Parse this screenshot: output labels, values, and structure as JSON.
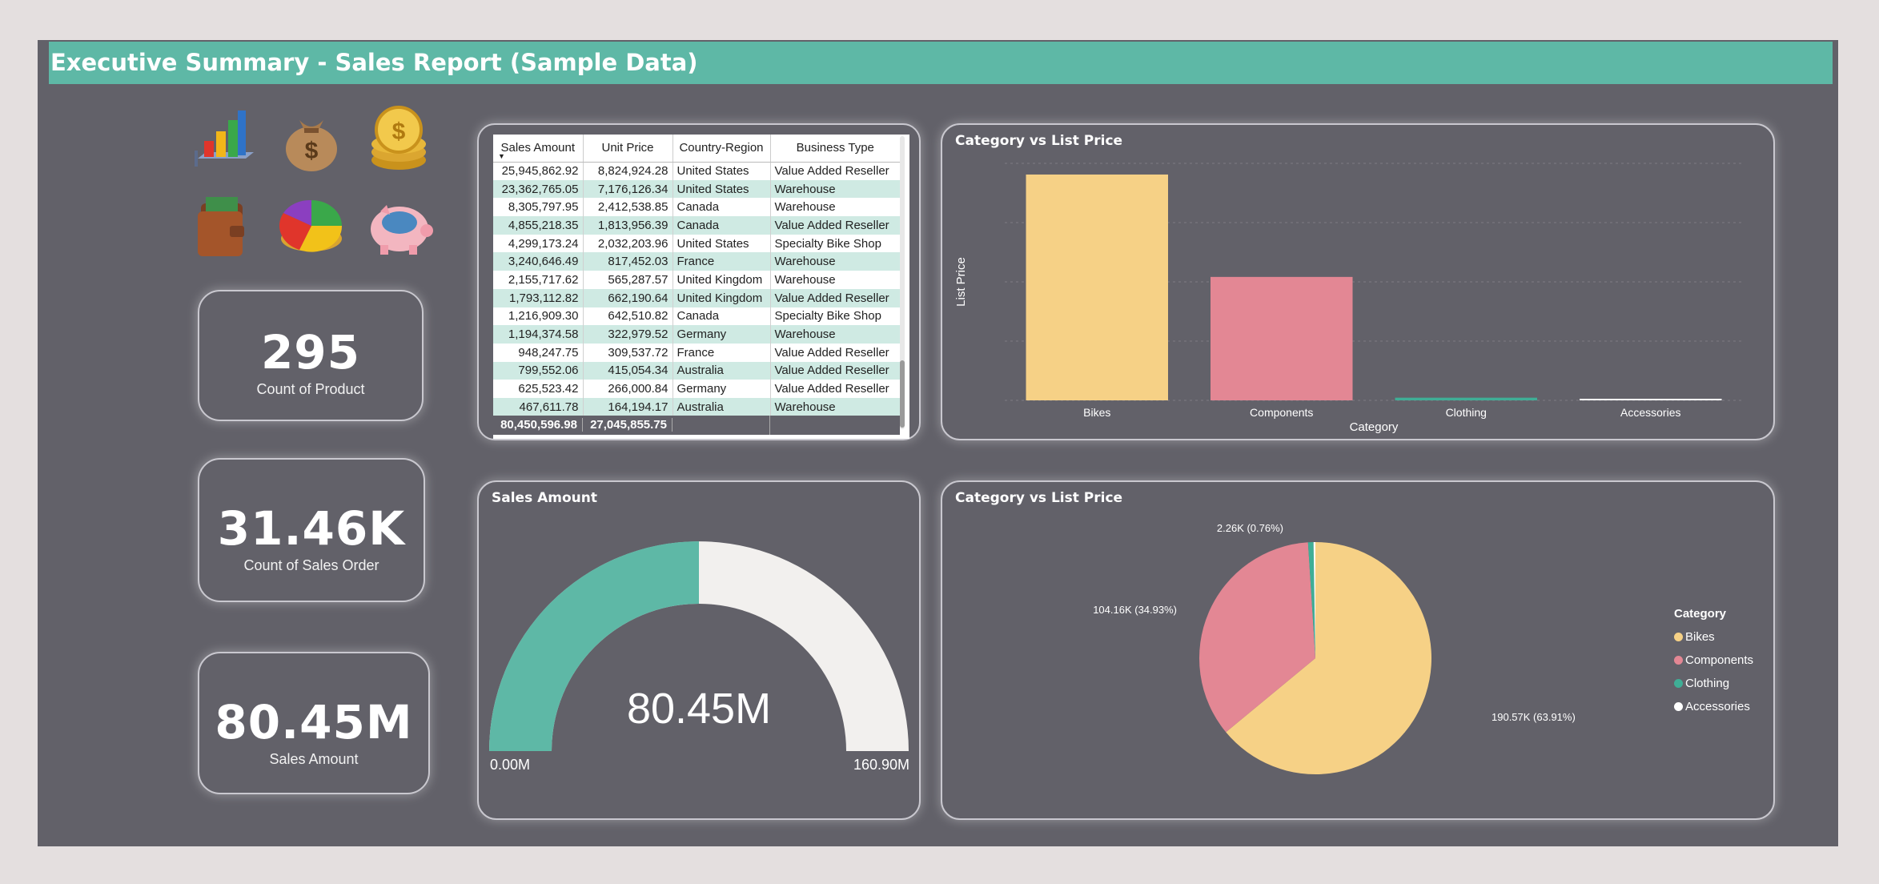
{
  "header": {
    "title": "Executive Summary - Sales Report (Sample Data)"
  },
  "icons": [
    "bar-chart-icon",
    "money-bag-icon",
    "gold-coins-icon",
    "wallet-icon",
    "pie-chart-icon",
    "piggy-bank-icon"
  ],
  "kpis": [
    {
      "value": "295",
      "label": "Count of Product"
    },
    {
      "value": "31.46K",
      "label": "Count of Sales Order"
    },
    {
      "value": "80.45M",
      "label": "Sales Amount"
    }
  ],
  "table": {
    "columns": [
      "Sales Amount",
      "Unit Price",
      "Country-Region",
      "Business Type"
    ],
    "rows": [
      [
        "25,945,862.92",
        "8,824,924.28",
        "United States",
        "Value Added Reseller"
      ],
      [
        "23,362,765.05",
        "7,176,126.34",
        "United States",
        "Warehouse"
      ],
      [
        "8,305,797.95",
        "2,412,538.85",
        "Canada",
        "Warehouse"
      ],
      [
        "4,855,218.35",
        "1,813,956.39",
        "Canada",
        "Value Added Reseller"
      ],
      [
        "4,299,173.24",
        "2,032,203.96",
        "United States",
        "Specialty Bike Shop"
      ],
      [
        "3,240,646.49",
        "817,452.03",
        "France",
        "Warehouse"
      ],
      [
        "2,155,717.62",
        "565,287.57",
        "United Kingdom",
        "Warehouse"
      ],
      [
        "1,793,112.82",
        "662,190.64",
        "United Kingdom",
        "Value Added Reseller"
      ],
      [
        "1,216,909.30",
        "642,510.82",
        "Canada",
        "Specialty Bike Shop"
      ],
      [
        "1,194,374.58",
        "322,979.52",
        "Germany",
        "Warehouse"
      ],
      [
        "948,247.75",
        "309,537.72",
        "France",
        "Value Added Reseller"
      ],
      [
        "799,552.06",
        "415,054.34",
        "Australia",
        "Value Added Reseller"
      ],
      [
        "625,523.42",
        "266,000.84",
        "Germany",
        "Value Added Reseller"
      ],
      [
        "467,611.78",
        "164,194.17",
        "Australia",
        "Warehouse"
      ]
    ],
    "totals": [
      "80,450,596.98",
      "27,045,855.75"
    ]
  },
  "gauge": {
    "title": "Sales Amount",
    "value_label": "80.45M",
    "min_label": "0.00M",
    "max_label": "160.90M",
    "value": 80.45,
    "max": 160.9
  },
  "colors": {
    "bikes": "#f6d186",
    "components": "#e38794",
    "clothing": "#3fae96",
    "accessories": "#ffffff",
    "teal": "#5eb8a6"
  },
  "chart_data": [
    {
      "type": "bar",
      "title": "Category vs List Price",
      "xlabel": "Category",
      "ylabel": "List Price",
      "categories": [
        "Bikes",
        "Components",
        "Clothing",
        "Accessories"
      ],
      "values": [
        190570,
        104160,
        2260,
        1000
      ],
      "ylim": [
        0,
        200000
      ],
      "grid": true
    },
    {
      "type": "pie",
      "title": "Category vs List Price",
      "legend_title": "Category",
      "legend_position": "right",
      "categories": [
        "Bikes",
        "Components",
        "Clothing",
        "Accessories"
      ],
      "values": [
        190570,
        104160,
        2260,
        760
      ],
      "data_labels": [
        "190.57K (63.91%)",
        "104.16K (34.93%)",
        "2.26K (0.76%)",
        ""
      ]
    }
  ]
}
